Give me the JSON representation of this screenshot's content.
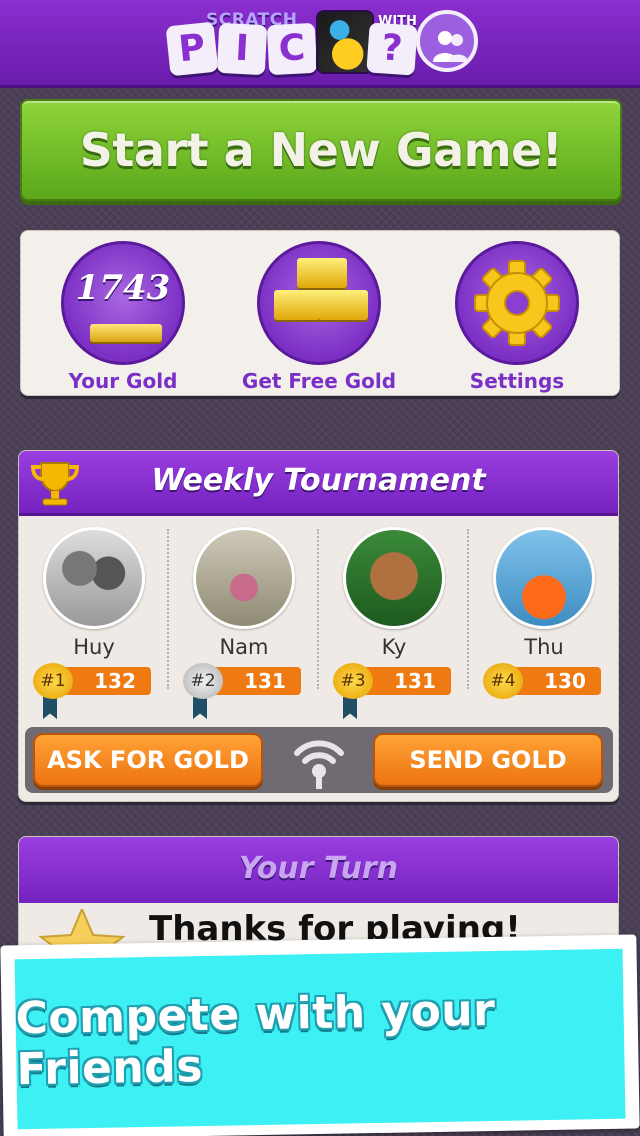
{
  "header": {
    "logo_small_top": "SCRATCH",
    "logo_with": "WITH",
    "logo_tiles": [
      "P",
      "I",
      "C",
      "?"
    ],
    "icons": {
      "parrot": "parrot-photo-tile",
      "friends": "friends-silhouette-icon"
    }
  },
  "start_button": {
    "label": "Start a New Game!"
  },
  "gold_panel": {
    "items": [
      {
        "value": "1743",
        "label": "Your Gold",
        "icon": "gold-bar-icon"
      },
      {
        "label": "Get Free Gold",
        "icon": "gold-stack-icon"
      },
      {
        "label": "Settings",
        "icon": "gear-icon"
      }
    ]
  },
  "tournament": {
    "title": "Weekly Tournament",
    "icon": "trophy-icon",
    "players": [
      {
        "name": "Huy",
        "rank": "#1",
        "score": "132"
      },
      {
        "name": "Nam",
        "rank": "#2",
        "score": "131"
      },
      {
        "name": "Ky",
        "rank": "#3",
        "score": "131"
      },
      {
        "name": "Thu",
        "rank": "#4",
        "score": "130"
      }
    ],
    "ask_label": "ASK FOR GOLD",
    "send_label": "SEND GOLD"
  },
  "your_turn": {
    "title": "Your Turn",
    "message": "Thanks for playing!"
  },
  "promo": {
    "text": "Compete with your Friends"
  },
  "colors": {
    "purple": "#7a2fc7",
    "green": "#6cbf24",
    "orange": "#f07a12",
    "cyan": "#3df0f3",
    "gold": "#f5c518"
  }
}
